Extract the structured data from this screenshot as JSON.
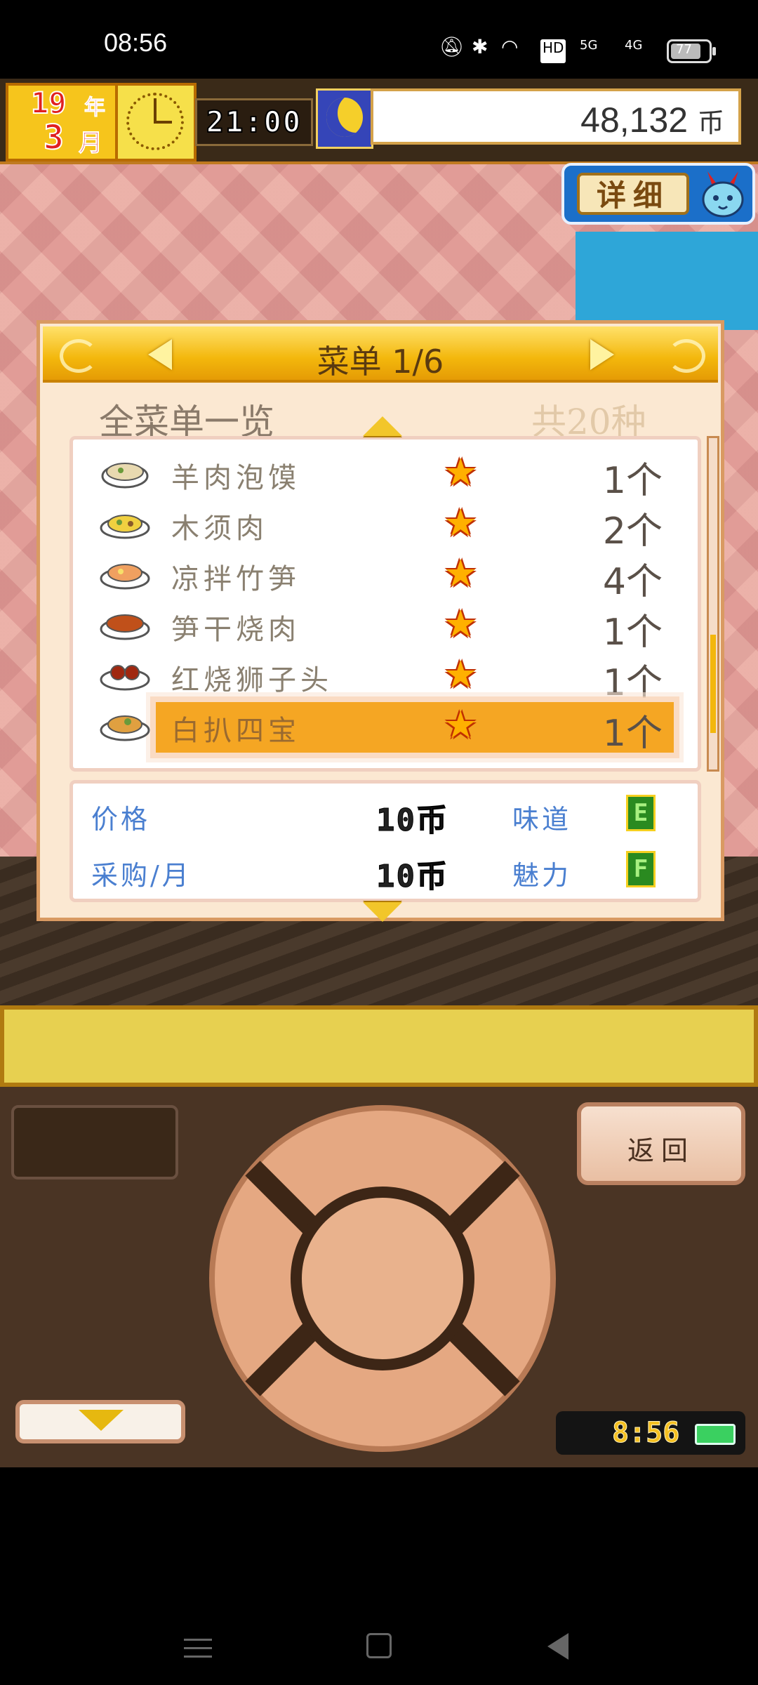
{
  "status_bar": {
    "time": "08:56",
    "battery_level": "77",
    "network_1": "HD",
    "network_2": "5G",
    "network_3": "4G"
  },
  "hud": {
    "year": "19",
    "year_label": "年",
    "month": "3",
    "month_label": "月",
    "game_time": "21:00",
    "money": "48,132",
    "currency": "币",
    "detail_button": "详细"
  },
  "menu": {
    "title": "菜单 1/6",
    "list_heading": "全菜单一览",
    "count": "共20种",
    "items": [
      {
        "name": "羊肉泡馍",
        "qty": "1个"
      },
      {
        "name": "木须肉",
        "qty": "2个"
      },
      {
        "name": "凉拌竹笋",
        "qty": "4个"
      },
      {
        "name": "笋干烧肉",
        "qty": "1个"
      },
      {
        "name": "红烧狮子头",
        "qty": "1个"
      },
      {
        "name": "白扒四宝",
        "qty": "1个"
      }
    ],
    "selected_index": 5,
    "info": {
      "price_label": "价格",
      "price_value": "10币",
      "taste_label": "味道",
      "taste_grade": "E",
      "purchase_label": "采购/月",
      "purchase_value": "10币",
      "charm_label": "魅力",
      "charm_grade": "F"
    }
  },
  "controls": {
    "back_button": "返回",
    "clock": "8:56"
  },
  "colors": {
    "accent": "#f3b70c",
    "selection": "#f5a623",
    "link_blue": "#4a7fd0"
  }
}
